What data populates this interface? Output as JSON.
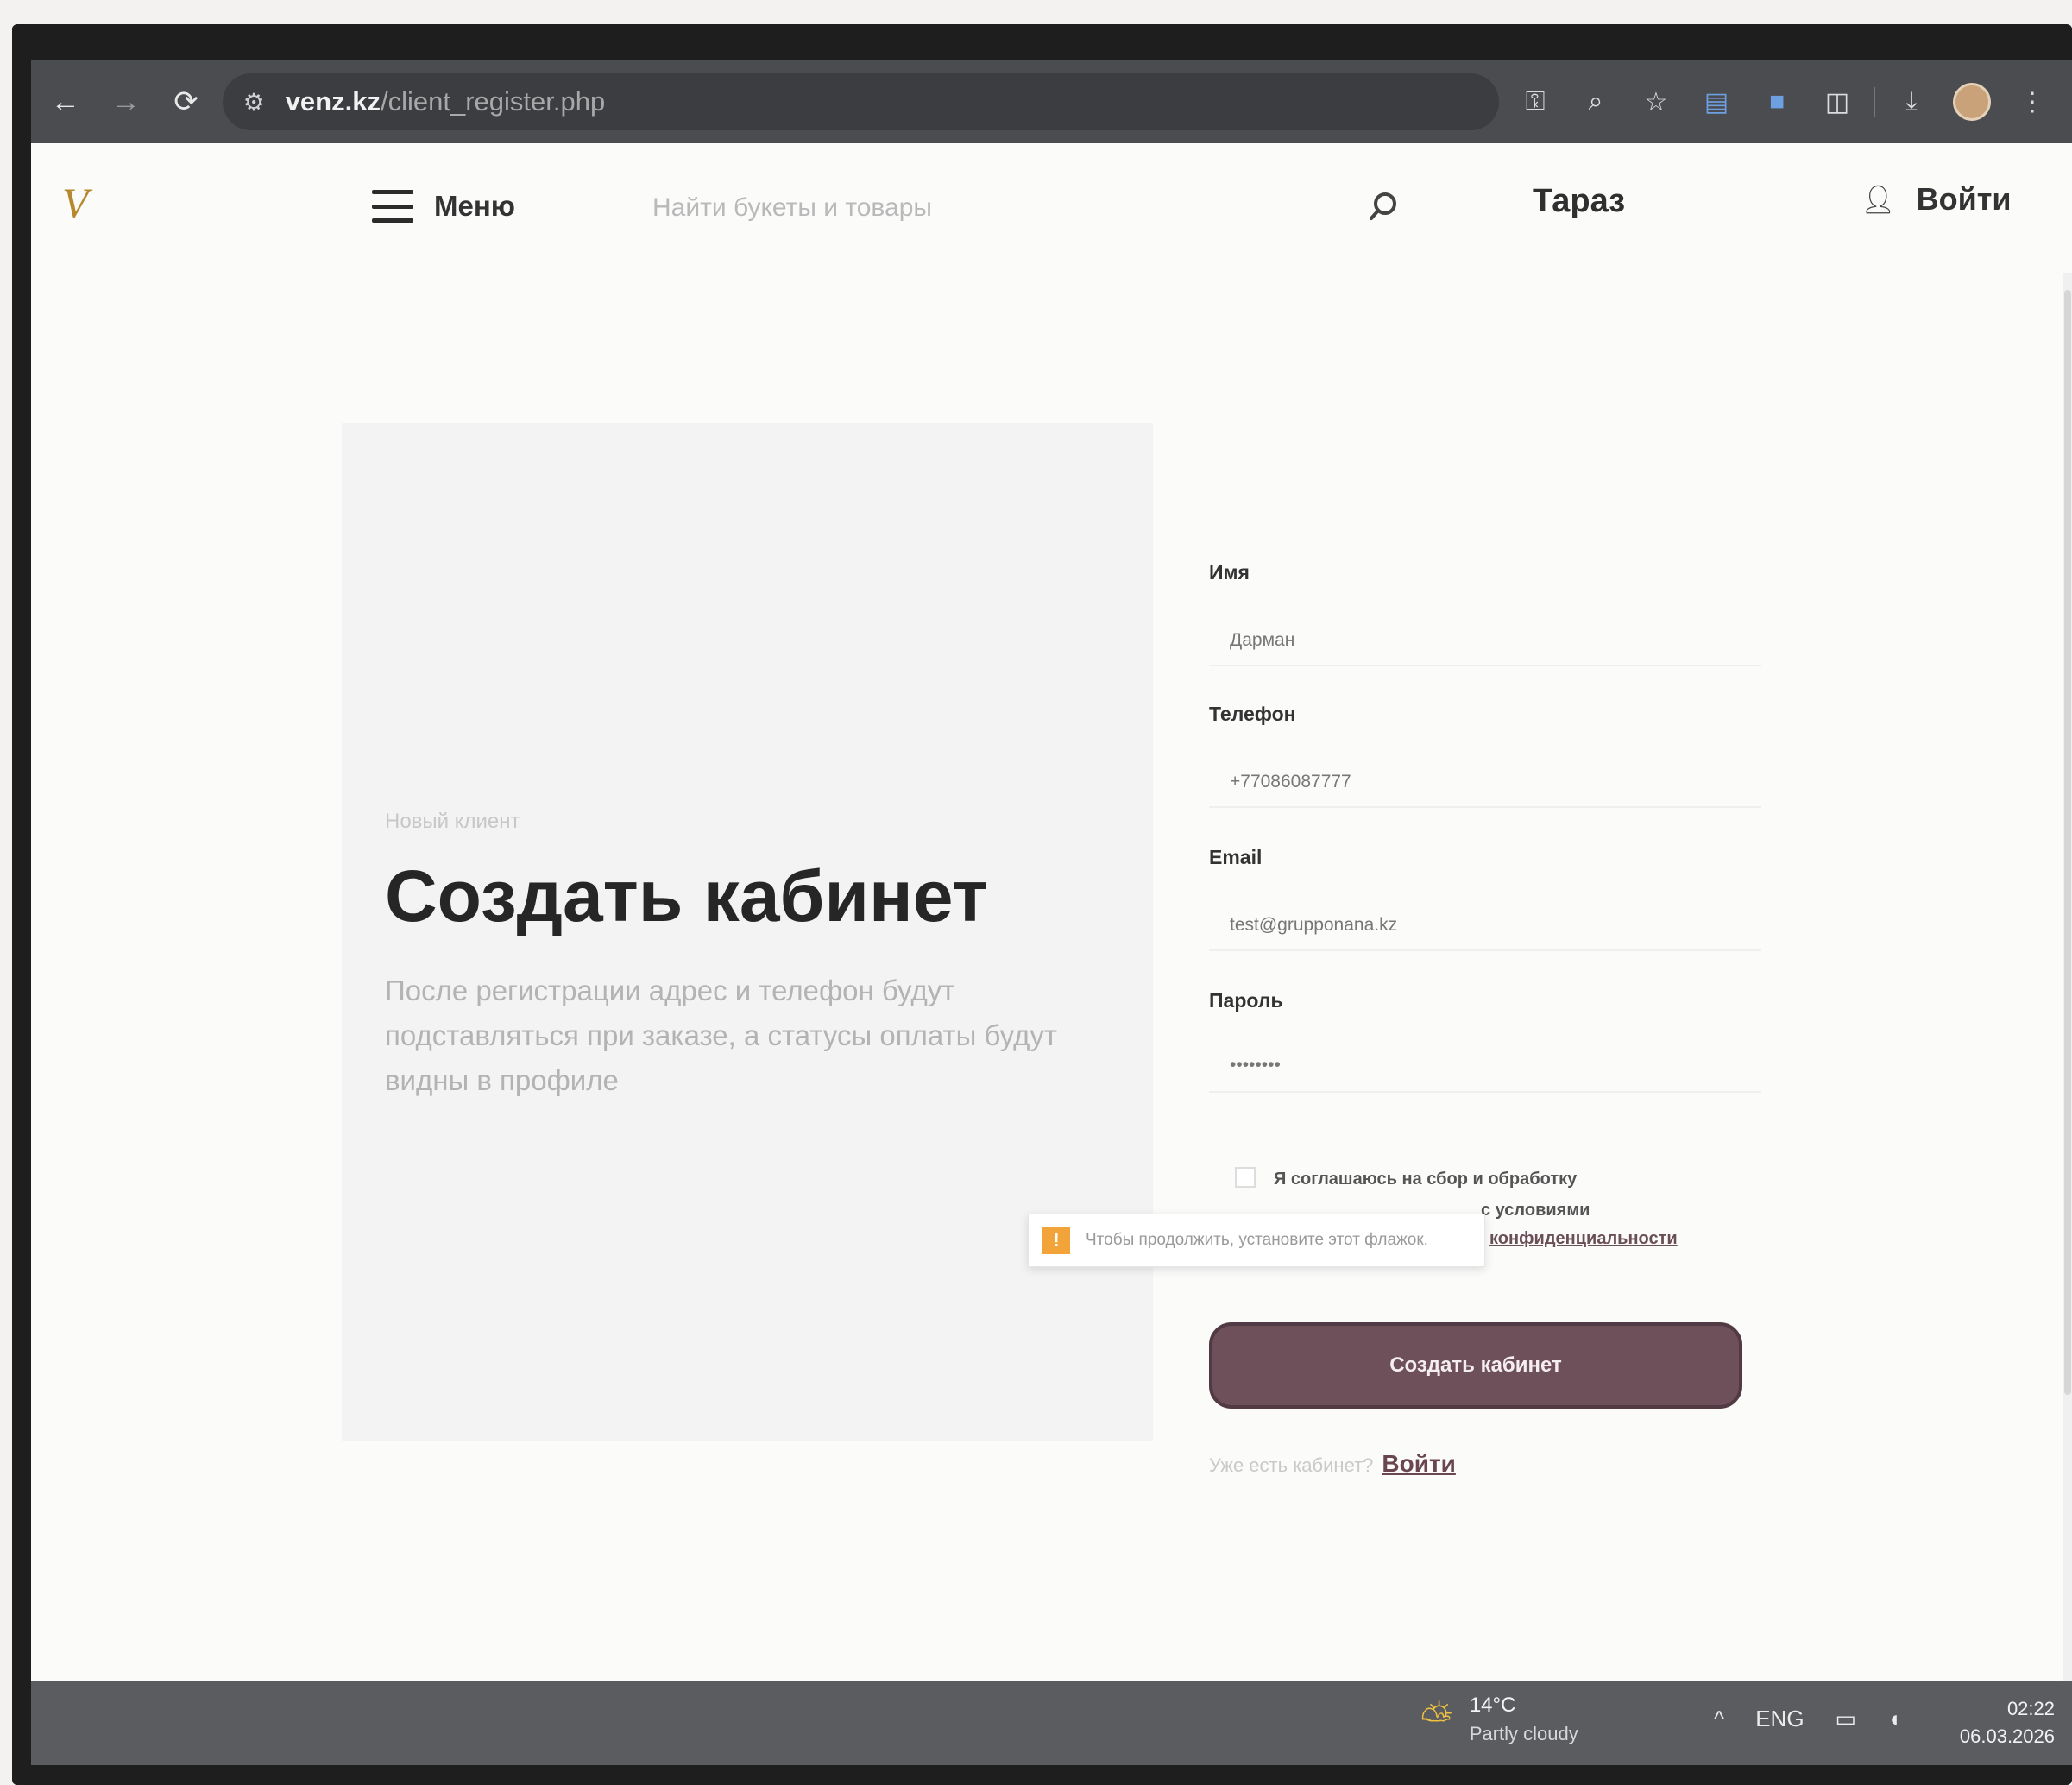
{
  "browser": {
    "url_host": "venz.kz",
    "url_path": "/client_register.php"
  },
  "header": {
    "logo_text": "V",
    "menu_label": "Меню",
    "search_placeholder": "Найти букеты и товары",
    "city": "Тараз",
    "login_label": "Войти"
  },
  "hero": {
    "overline": "Новый клиент",
    "title": "Создать кабинет",
    "description": "После регистрации адрес и телефон будут подставляться при заказе, а статусы оплаты будут видны в профиле"
  },
  "form": {
    "name_label": "Имя",
    "name_value": "Дарман",
    "phone_label": "Телефон",
    "phone_value": "+77086087777",
    "email_label": "Email",
    "email_value": "test@grupponana.kz",
    "password_label": "Пароль",
    "password_value": "••••••••",
    "consent_text": "Я соглашаюсь на сбор и обработку",
    "consent_text2": "с условиями",
    "privacy_link": "конфиденциальности",
    "tooltip_message": "Чтобы продолжить, установите этот флажок.",
    "submit_label": "Создать кабинет",
    "have_account": "Уже есть кабинет?",
    "login_link": "Войти"
  },
  "taskbar": {
    "temperature": "14°C",
    "weather": "Partly cloudy",
    "language": "ENG",
    "time": "02:22",
    "date": "06.03.2026"
  },
  "icons": {
    "back": "arrow-left-icon",
    "forward": "arrow-right-icon",
    "reload": "reload-icon",
    "search": "search-icon",
    "user": "user-icon",
    "warning": "warning-icon"
  }
}
